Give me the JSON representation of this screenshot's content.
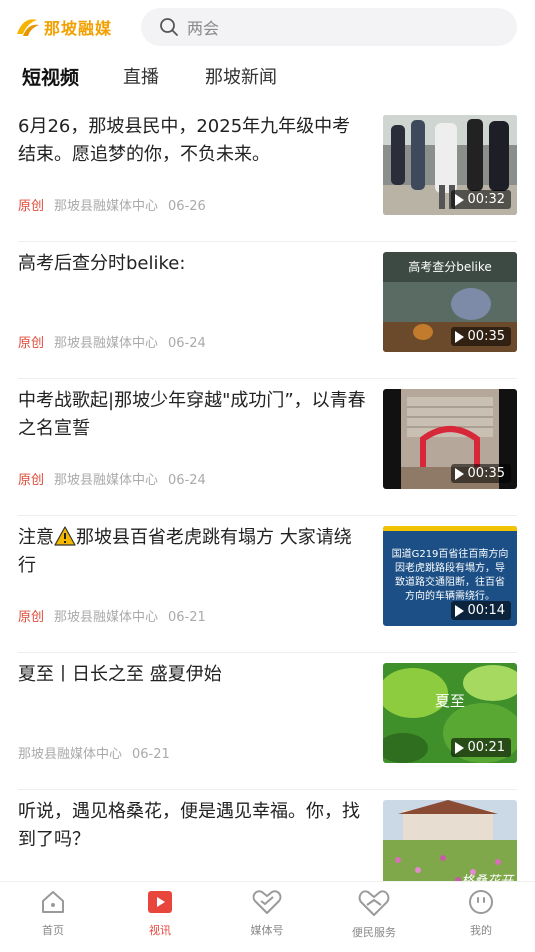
{
  "header": {
    "logo_text": "那坡融媒",
    "search_placeholder": "两会"
  },
  "tabs": [
    {
      "label": "短视频",
      "active": true
    },
    {
      "label": "直播",
      "active": false
    },
    {
      "label": "那坡新闻",
      "active": false
    }
  ],
  "items": [
    {
      "title": "6月26，那坡县民中，2025年九年级中考结束。愿追梦的你，不负未来。",
      "tag": "原创",
      "source": "那坡县融媒体中心",
      "date": "06-26",
      "duration": "00:32",
      "thumb_caption": ""
    },
    {
      "title": "高考后查分时belike:",
      "tag": "原创",
      "source": "那坡县融媒体中心",
      "date": "06-24",
      "duration": "00:35",
      "thumb_caption": "高考查分belike"
    },
    {
      "title": "中考战歌起|那坡少年穿越\"成功门”，以青春之名宣誓",
      "tag": "原创",
      "source": "那坡县融媒体中心",
      "date": "06-24",
      "duration": "00:35",
      "thumb_caption": ""
    },
    {
      "title_before": "注意",
      "title_after": "那坡县百省老虎跳有塌方 大家请绕行",
      "tag": "原创",
      "source": "那坡县融媒体中心",
      "date": "06-21",
      "duration": "00:14",
      "thumb_caption": "国道G219百省往百南方向因老虎跳路段有塌方，导致道路交通阻断，往百省方向的车辆需绕行。"
    },
    {
      "title": "夏至丨日长之至 盛夏伊始",
      "tag": "",
      "source": "那坡县融媒体中心",
      "date": "06-21",
      "duration": "00:21",
      "thumb_caption": "夏至"
    },
    {
      "title": "听说，遇见格桑花，便是遇见幸福。你，找到了吗？",
      "tag": "",
      "source": "",
      "date": "",
      "duration": "",
      "thumb_caption": "格桑花开"
    }
  ],
  "bottom_nav": [
    {
      "label": "首页",
      "icon": "home-icon",
      "active": false
    },
    {
      "label": "视讯",
      "icon": "video-icon",
      "active": true
    },
    {
      "label": "媒体号",
      "icon": "media-icon",
      "active": false
    },
    {
      "label": "便民服务",
      "icon": "service-icon",
      "active": false
    },
    {
      "label": "我的",
      "icon": "profile-icon",
      "active": false
    }
  ],
  "colors": {
    "accent": "#e8453c",
    "tag": "#e04a3a",
    "logo": "#f2a100"
  }
}
